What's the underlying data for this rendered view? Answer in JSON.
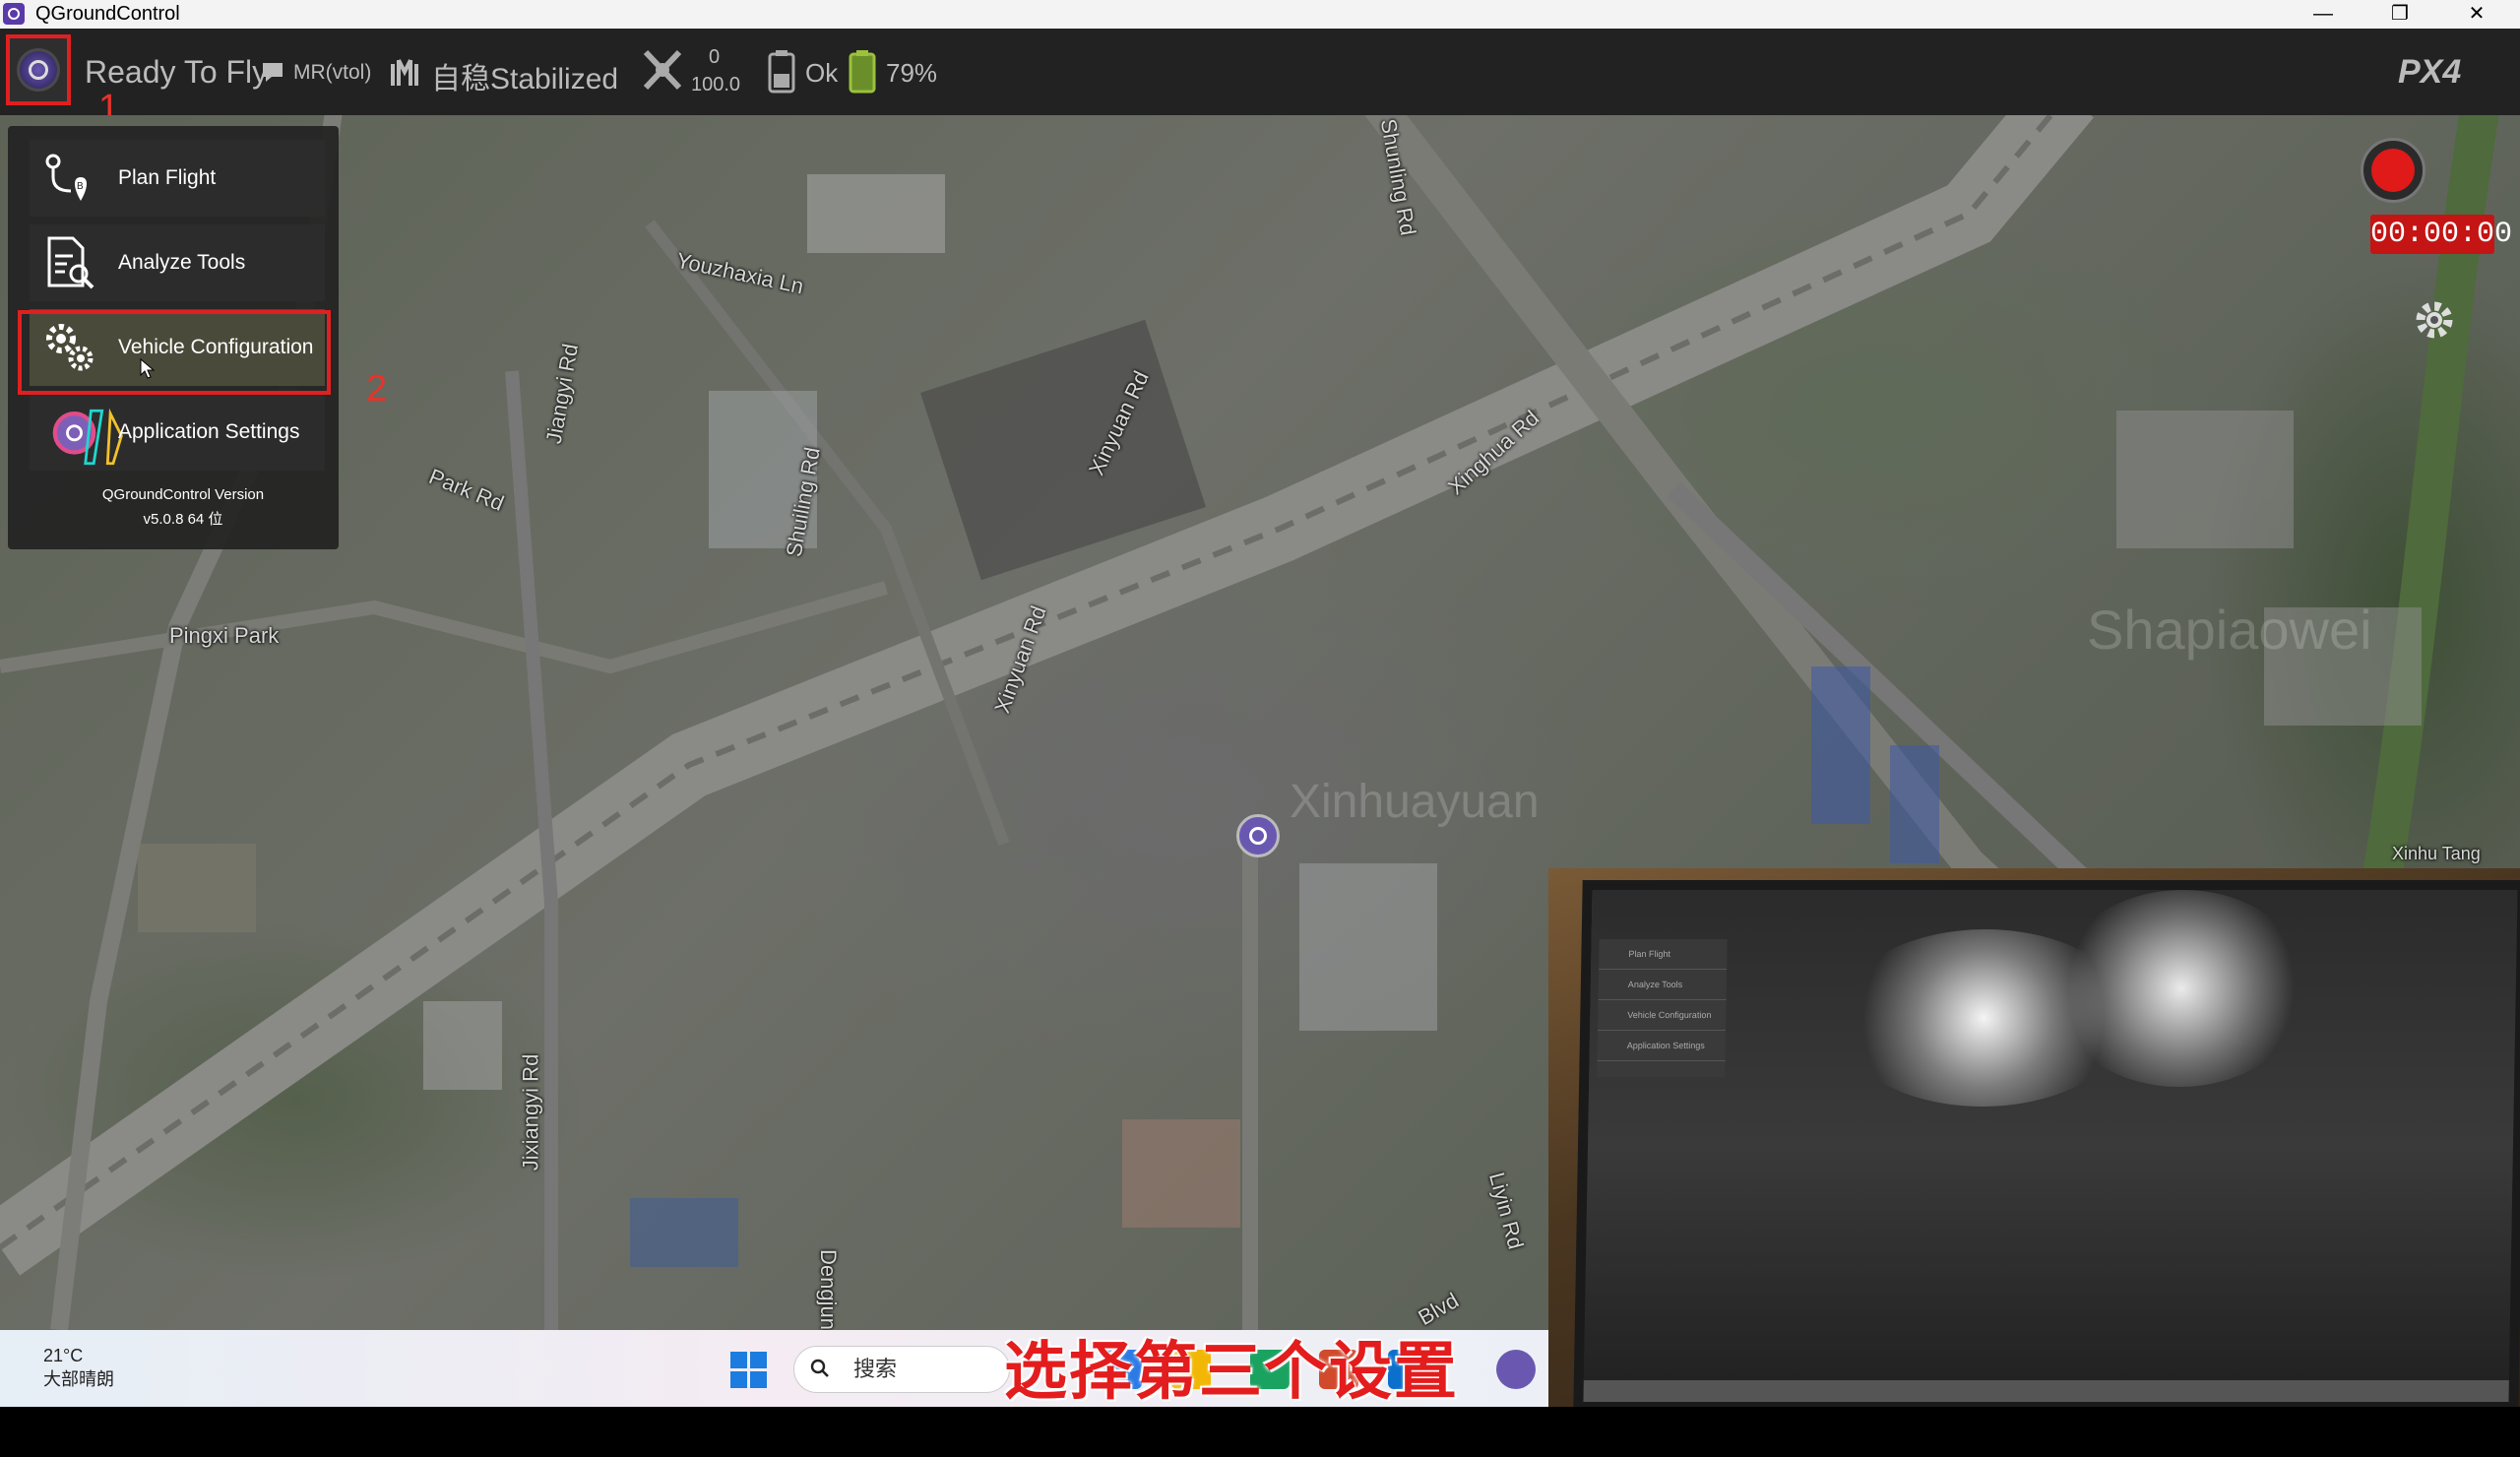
{
  "window": {
    "title": "QGroundControl",
    "controls": [
      "—",
      "❐",
      "✕"
    ]
  },
  "toolbar": {
    "status": "Ready To Fly",
    "vehicle_type": "MR(vtol)",
    "flight_mode": "自稳Stabilized",
    "rc_rssi_top": "0",
    "rc_rssi_bottom": "100.0",
    "gps_status": "Ok",
    "battery": "79%",
    "brand_logo": "PX4 autopilot",
    "annotation_1": "1"
  },
  "menu": {
    "items": [
      {
        "label": "Plan Flight",
        "icon": "plan-flight-icon"
      },
      {
        "label": "Analyze Tools",
        "icon": "analyze-tools-icon"
      },
      {
        "label": "Vehicle Configuration",
        "icon": "vehicle-config-gear-icon"
      },
      {
        "label": "Application Settings",
        "icon": "app-settings-icon"
      }
    ],
    "version_line1": "QGroundControl Version",
    "version_line2": "v5.0.8 64 位",
    "annotation_2": "2"
  },
  "map": {
    "labels": {
      "youzhaxia": "Youzhaxia Ln",
      "park": "Park Rd",
      "pingxi": "Pingxi Park",
      "jiangyi": "Jiangyi Rd",
      "shuiling": "Shuiling Rd",
      "xinyuan1": "Xinyuan Rd",
      "xinyuan2": "Xinyuan Rd",
      "xinghua": "Xinghua Rd",
      "shunling": "Shunling Rd",
      "jixiangyi": "Jixiangyi Rd",
      "dengjun": "Dengjun",
      "liyin": "Liyin Rd",
      "blvd": "Blvd",
      "xinhua": "Xinhu Tang",
      "shapi": "Shapiaowei",
      "xinhuayuan": "Xinhuayuan"
    }
  },
  "video": {
    "timer": "00:00:00",
    "record_color": "#e01919"
  },
  "taskbar": {
    "temperature": "21°C",
    "weather": "大部晴朗",
    "search_placeholder": "搜索"
  },
  "subtitle": "选择第三个设置",
  "colors": {
    "annotation_red": "#e8332a",
    "toolbar_bg": "#222222",
    "accent_purple": "#6a58b0"
  }
}
